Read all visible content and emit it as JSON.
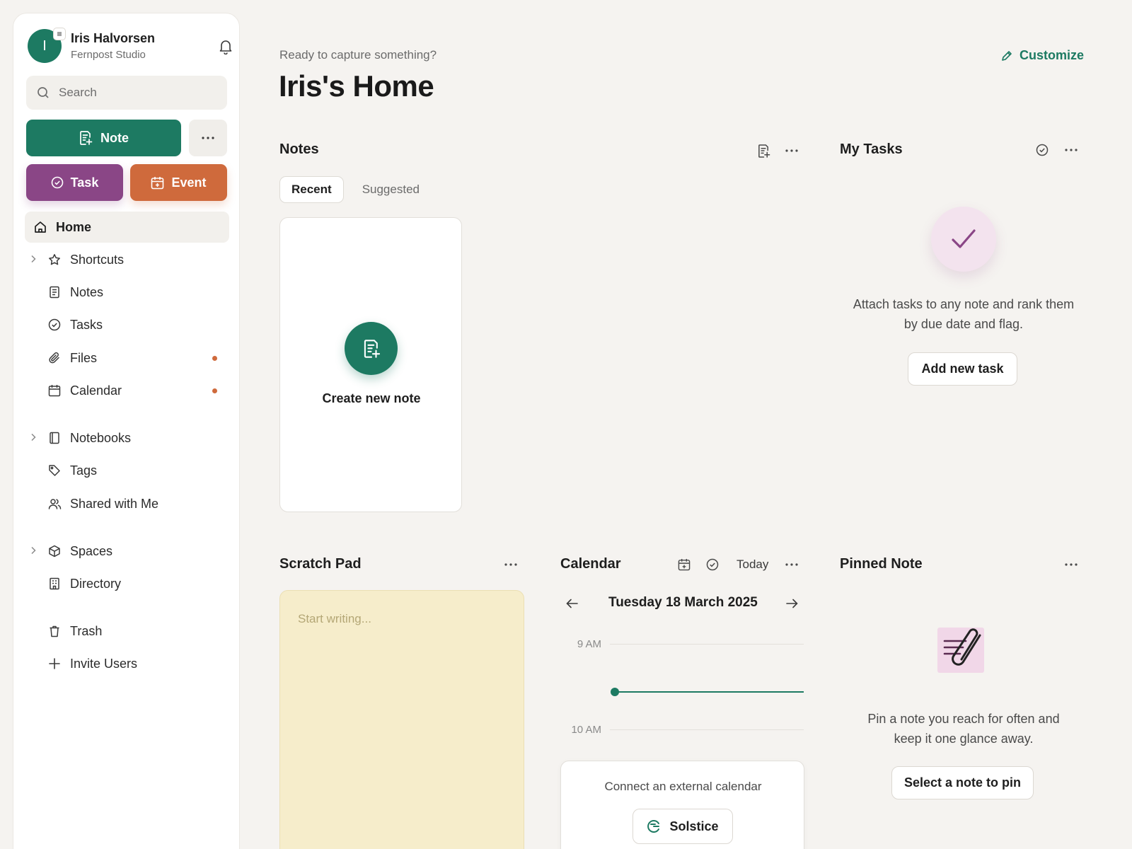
{
  "colors": {
    "brand_green": "#1d7a62",
    "task_purple": "#8a4686",
    "event_orange": "#cf6a3c",
    "scratch_yellow": "#f6edcb"
  },
  "user": {
    "initial": "I",
    "name": "Iris Halvorsen",
    "org": "Fernpost Studio"
  },
  "sidebar": {
    "search_placeholder": "Search",
    "note_button": "Note",
    "task_button": "Task",
    "event_button": "Event",
    "items": [
      {
        "label": "Home",
        "icon": "home-icon",
        "active": true
      },
      {
        "label": "Shortcuts",
        "icon": "star-icon",
        "expandable": true
      },
      {
        "label": "Notes",
        "icon": "note-icon"
      },
      {
        "label": "Tasks",
        "icon": "check-circle-icon"
      },
      {
        "label": "Files",
        "icon": "paperclip-icon",
        "unread": true
      },
      {
        "label": "Calendar",
        "icon": "calendar-icon",
        "unread": true
      },
      {
        "label": "Notebooks",
        "icon": "notebook-icon",
        "expandable": true
      },
      {
        "label": "Tags",
        "icon": "tag-icon"
      },
      {
        "label": "Shared with Me",
        "icon": "users-icon"
      },
      {
        "label": "Spaces",
        "icon": "cube-icon",
        "expandable": true
      },
      {
        "label": "Directory",
        "icon": "building-icon"
      },
      {
        "label": "Trash",
        "icon": "trash-icon"
      },
      {
        "label": "Invite Users",
        "icon": "plus-icon"
      }
    ]
  },
  "header": {
    "greeting": "Ready to capture something?",
    "title": "Iris's Home",
    "customize": "Customize"
  },
  "notes": {
    "title": "Notes",
    "tabs": [
      {
        "label": "Recent",
        "active": true
      },
      {
        "label": "Suggested",
        "active": false
      }
    ],
    "create_label": "Create new note"
  },
  "tasks": {
    "title": "My Tasks",
    "empty_text_1": "Attach tasks to any note and rank them",
    "empty_text_2": "by due date and flag.",
    "add_button": "Add new task"
  },
  "scratch": {
    "title": "Scratch Pad",
    "placeholder": "Start writing..."
  },
  "calendar": {
    "title": "Calendar",
    "today": "Today",
    "date": "Tuesday 18 March 2025",
    "hours": [
      "9 AM",
      "10 AM"
    ],
    "connect_text": "Connect an external calendar",
    "connect_button": "Solstice"
  },
  "pinned": {
    "title": "Pinned Note",
    "empty_text_1": "Pin a note you reach for often and",
    "empty_text_2": "keep it one glance away.",
    "select_button": "Select a note to pin"
  }
}
